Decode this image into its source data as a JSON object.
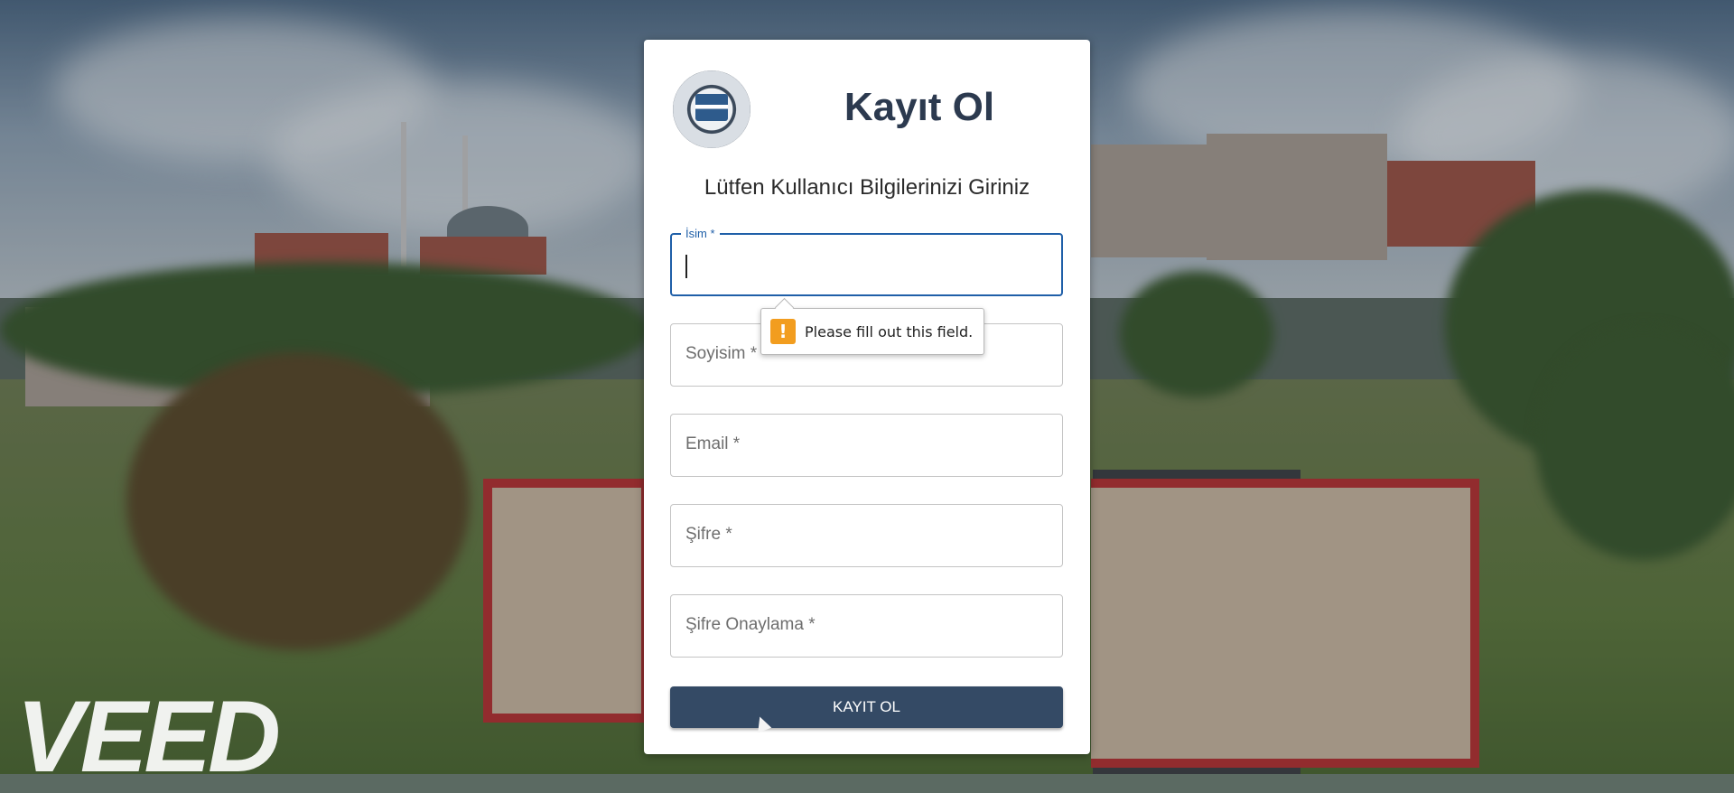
{
  "form": {
    "title": "Kayıt Ol",
    "subtitle": "Lütfen Kullanıcı Bilgilerinizi Giriniz",
    "fields": [
      {
        "label": "İsim *",
        "value": ""
      },
      {
        "label": "Soyisim *",
        "value": ""
      },
      {
        "label": "Email *",
        "value": ""
      },
      {
        "label": "Şifre *",
        "value": ""
      },
      {
        "label": "Şifre Onaylama *",
        "value": ""
      }
    ],
    "submit_label": "KAYIT OL"
  },
  "validation": {
    "message": "Please fill out this field.",
    "icon": "warning-icon",
    "icon_glyph": "!"
  },
  "watermark": {
    "text": "VEED"
  },
  "colors": {
    "primary_button": "#344a65",
    "focus": "#1f5fa8",
    "title": "#2c3a4f",
    "warning": "#f29d1f"
  }
}
